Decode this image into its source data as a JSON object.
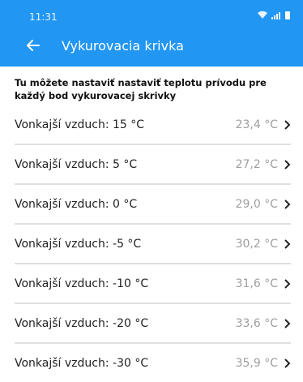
{
  "status_bar": {
    "time": "11:31"
  },
  "header": {
    "title": "Vykurovacia krivka"
  },
  "description": "Tu môžete nastaviť nastaviť teplotu prívodu pre každý bod vykurovacej skrivky",
  "rows": [
    {
      "label": "Vonkajší vzduch: 15 °C",
      "value": "23,4 °C"
    },
    {
      "label": "Vonkajší vzduch: 5 °C",
      "value": "27,2 °C"
    },
    {
      "label": "Vonkajší vzduch: 0 °C",
      "value": "29,0 °C"
    },
    {
      "label": "Vonkajší vzduch: -5 °C",
      "value": "30,2 °C"
    },
    {
      "label": "Vonkajší vzduch: -10 °C",
      "value": "31,6 °C"
    },
    {
      "label": "Vonkajší vzduch: -20 °C",
      "value": "33,6 °C"
    },
    {
      "label": "Vonkajší vzduch: -30 °C",
      "value": "35,9 °C"
    }
  ],
  "colors": {
    "appbar": "#2196f3",
    "value_text": "#9e9e9e"
  }
}
